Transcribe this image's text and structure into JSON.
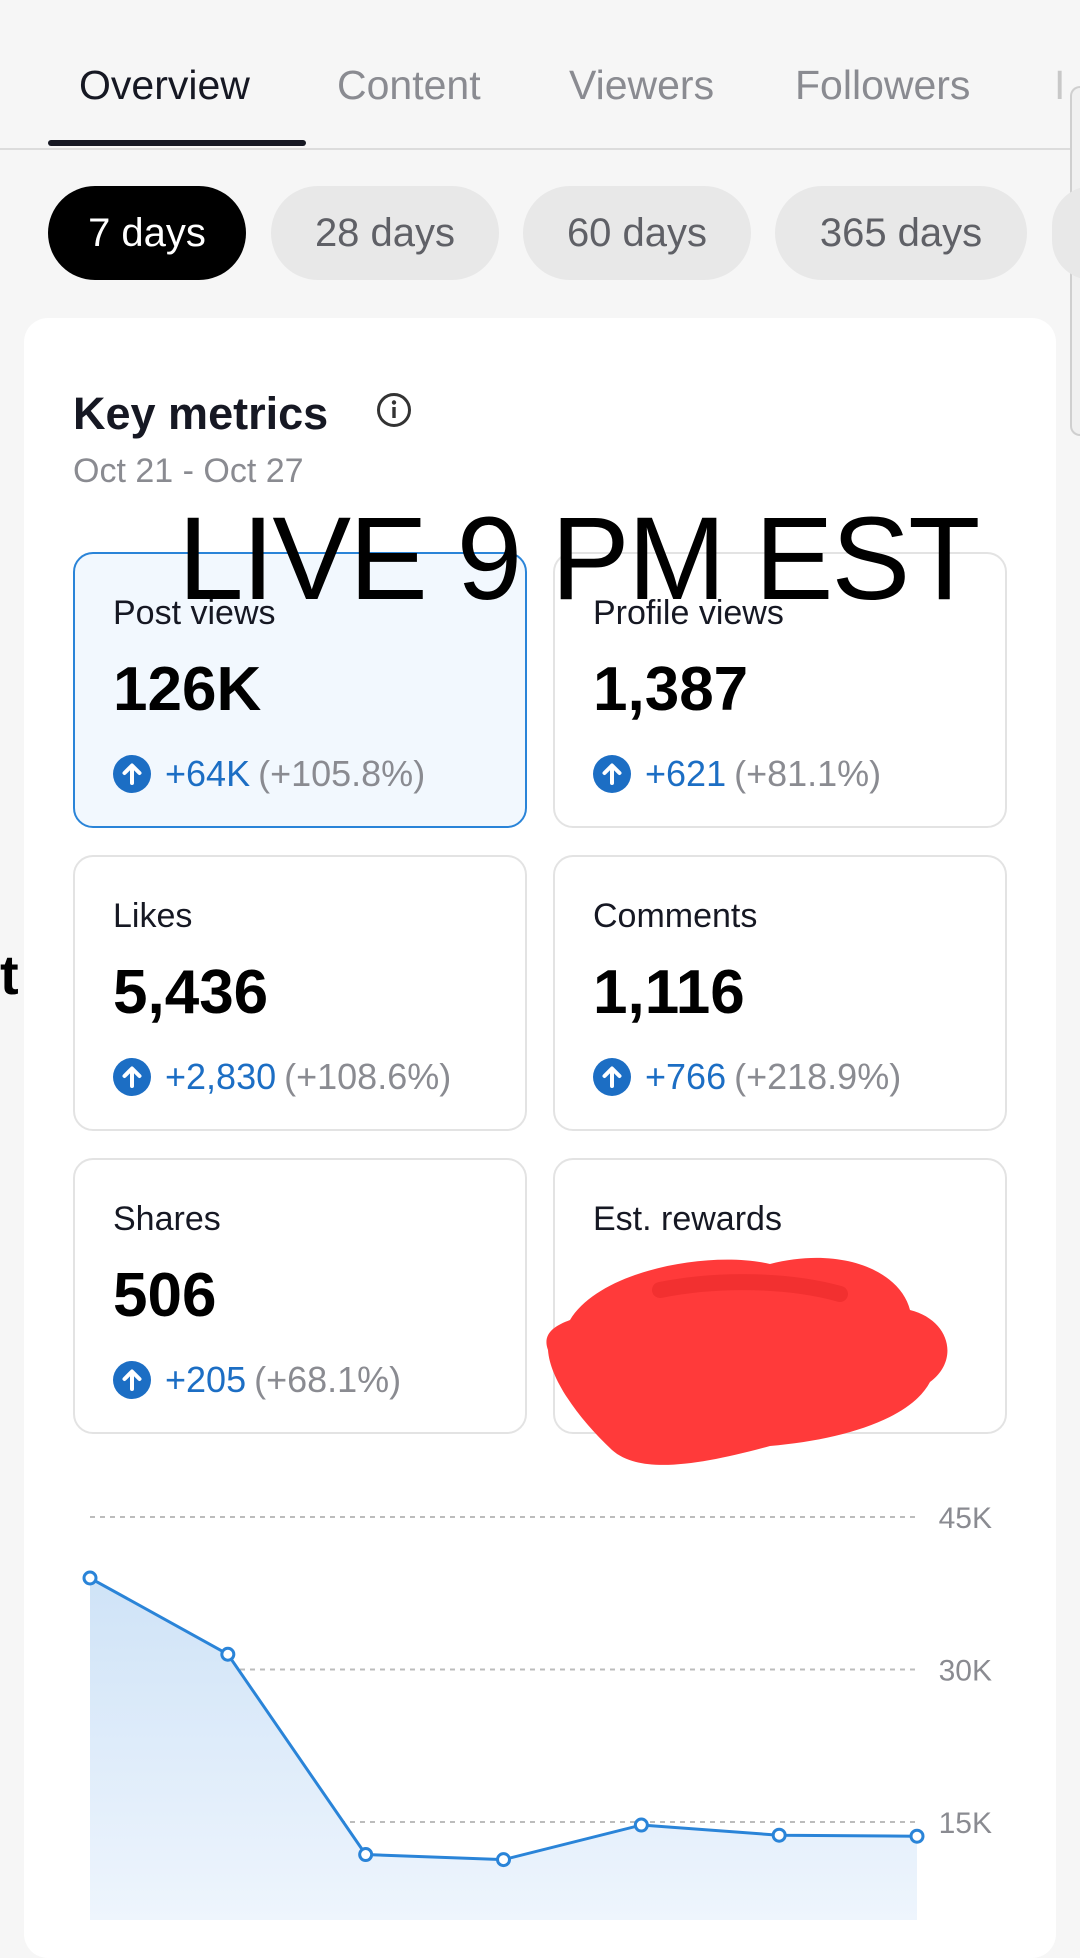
{
  "tabs": [
    {
      "label": "Overview",
      "active": true
    },
    {
      "label": "Content",
      "active": false
    },
    {
      "label": "Viewers",
      "active": false
    },
    {
      "label": "Followers",
      "active": false
    }
  ],
  "tab_overflow_glyph": "I",
  "periods": [
    {
      "label": "7 days",
      "active": true
    },
    {
      "label": "28 days",
      "active": false
    },
    {
      "label": "60 days",
      "active": false
    },
    {
      "label": "365 days",
      "active": false
    }
  ],
  "key_metrics": {
    "title": "Key metrics",
    "date_range": "Oct 21 - Oct 27"
  },
  "metrics": [
    {
      "label": "Post views",
      "value": "126K",
      "delta": "+64K",
      "pct": "(+105.8%)",
      "selected": true
    },
    {
      "label": "Profile views",
      "value": "1,387",
      "delta": "+621",
      "pct": "(+81.1%)",
      "selected": false
    },
    {
      "label": "Likes",
      "value": "5,436",
      "delta": "+2,830",
      "pct": "(+108.6%)",
      "selected": false
    },
    {
      "label": "Comments",
      "value": "1,116",
      "delta": "+766",
      "pct": "(+218.9%)",
      "selected": false
    },
    {
      "label": "Shares",
      "value": "506",
      "delta": "+205",
      "pct": "(+68.1%)",
      "selected": false
    },
    {
      "label": "Est. rewards",
      "value": "",
      "delta": "",
      "pct": "",
      "selected": false,
      "redacted": true
    }
  ],
  "overlay_text": "LIVE 9 PM EST",
  "edge_letter": "t",
  "colors": {
    "accent": "#1c6ec4",
    "selected_border": "#2a84d8",
    "line": "#2a84d8",
    "redaction": "#ff3a3a"
  },
  "chart_data": {
    "type": "area",
    "x": [
      1,
      2,
      3,
      4,
      5,
      6,
      7
    ],
    "y": [
      39000,
      31500,
      11800,
      11300,
      14700,
      13700,
      13600
    ],
    "yticks": [
      15000,
      30000,
      45000
    ],
    "ytick_labels": [
      "15K",
      "30K",
      "45K"
    ],
    "ylim": [
      8000,
      45000
    ],
    "grid": true
  }
}
